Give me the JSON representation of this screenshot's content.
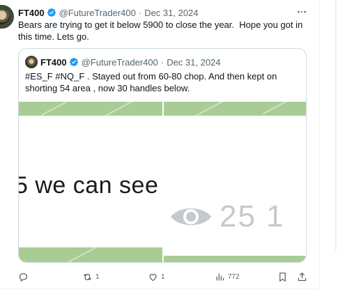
{
  "tweet": {
    "author_name": "FT400",
    "handle": "@FutureTrader400",
    "separator": "·",
    "date": "Dec 31, 2024",
    "text": "Bears are trying to get it below 5900 to close the year.  Hope you got in this time. Lets go."
  },
  "quote": {
    "author_name": "FT400",
    "handle": "@FutureTrader400",
    "separator": "·",
    "date": "Dec 31, 2024",
    "text": "#ES_F #NQ_F . Stayed out from 60-80 chop. And then  kept on shorting 54 area , now 30 handles below.",
    "media": {
      "left_image_text": "5 we can see",
      "right_image_text": "25  1"
    }
  },
  "actions": {
    "reply_count": "",
    "retweet_count": "1",
    "like_count": "1",
    "views_count": "772"
  },
  "icons": [
    "verified-badge-icon",
    "more-options-icon",
    "reply-icon",
    "retweet-icon",
    "like-icon",
    "views-icon",
    "bookmark-icon",
    "share-icon",
    "eye-icon"
  ],
  "colors": {
    "accent": "#1d9bf0",
    "muted": "#536471",
    "text": "#0f1419",
    "border": "#cfd9de",
    "image_band": "#a9cc94"
  }
}
